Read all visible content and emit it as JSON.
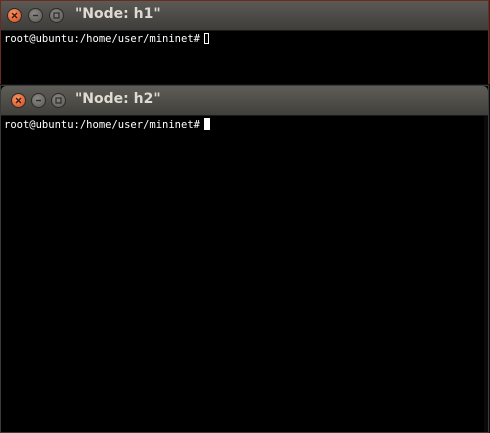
{
  "windows": {
    "h1": {
      "title": "\"Node: h1\"",
      "prompt": "root@ubuntu:/home/user/mininet#",
      "cursor": "hollow"
    },
    "h2": {
      "title": "\"Node: h2\"",
      "prompt": "root@ubuntu:/home/user/mininet#",
      "cursor": "solid"
    }
  },
  "icons": [
    "close-icon",
    "minimize-icon",
    "maximize-icon"
  ],
  "colors": {
    "desktop": "#4a1f1a",
    "terminal_bg": "#000000",
    "terminal_fg": "#ffffff",
    "close_button": "#e0531f",
    "titlebar": "#4a4945"
  }
}
